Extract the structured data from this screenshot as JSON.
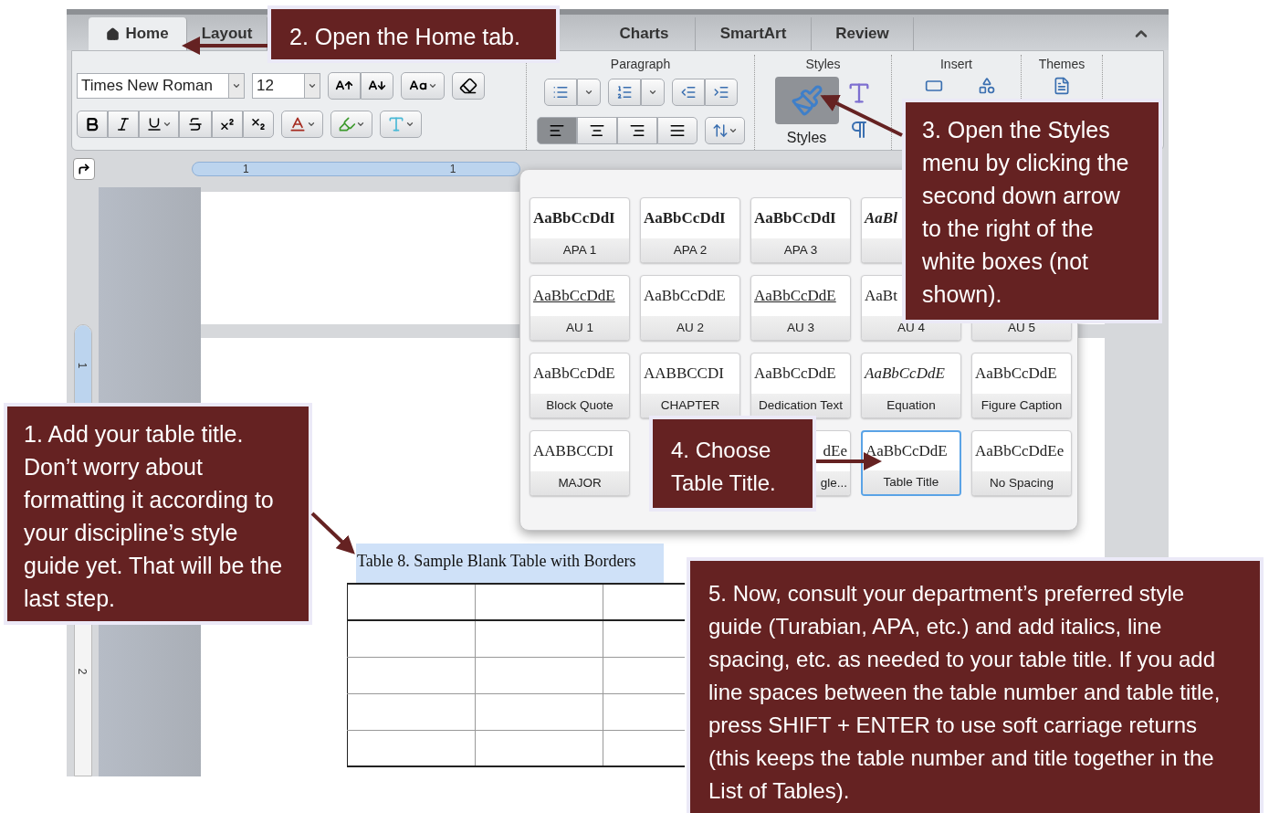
{
  "tabs": [
    {
      "label": "Home",
      "selected": true
    },
    {
      "label": "Layout",
      "selected": false
    },
    {
      "label": "Charts",
      "selected": false
    },
    {
      "label": "SmartArt",
      "selected": false
    },
    {
      "label": "Review",
      "selected": false
    }
  ],
  "ribbon": {
    "font_name": "Times New Roman",
    "font_size": "12",
    "groups": [
      {
        "label": "Paragraph"
      },
      {
        "label": "Styles"
      },
      {
        "label": "Insert"
      },
      {
        "label": "Themes"
      }
    ],
    "alignment": [
      {
        "kind": "left",
        "selected": true
      },
      {
        "kind": "center",
        "selected": false
      },
      {
        "kind": "right",
        "selected": false
      },
      {
        "kind": "justify",
        "selected": false
      }
    ],
    "styles_button": "Styles"
  },
  "horizontal_ruler": [
    "1",
    "1"
  ],
  "vertical_ruler": [
    "1",
    "2"
  ],
  "styles_gallery": {
    "rows": [
      [
        {
          "sample": "AaBbCcDdI",
          "kind": "bold",
          "label": "APA 1",
          "selected": false
        },
        {
          "sample": "AaBbCcDdI",
          "kind": "bold",
          "label": "APA 2",
          "selected": false
        },
        {
          "sample": "AaBbCcDdI",
          "kind": "bold",
          "label": "APA 3",
          "selected": false
        },
        {
          "sample": "AaBl",
          "kind": "bolditalic",
          "selected": false
        },
        null
      ],
      [
        {
          "sample": "AaBbCcDdE",
          "kind": "underline",
          "label": "AU 1",
          "selected": false
        },
        {
          "sample": "AaBbCcDdE",
          "kind": "plain",
          "label": "AU 2",
          "selected": false
        },
        {
          "sample": "AaBbCcDdE",
          "kind": "underline",
          "label": "AU 3",
          "selected": false
        },
        {
          "sample": "AaBt",
          "kind": "plain",
          "label": "AU 4",
          "selected": false
        },
        {
          "label": "AU 5",
          "kind": "plain",
          "selected": false
        }
      ],
      [
        {
          "sample": "AaBbCcDdE",
          "kind": "plain",
          "label": "Block Quote",
          "selected": false
        },
        {
          "sample": "AABBCCDI",
          "kind": "plain",
          "label": "CHAPTER",
          "selected": false
        },
        {
          "sample": "AaBbCcDdE",
          "kind": "plain",
          "label": "Dedication Text",
          "selected": false
        },
        {
          "sample": "AaBbCcDdE",
          "kind": "italic",
          "label": "Equation",
          "selected": false
        },
        {
          "sample": "AaBbCcDdE",
          "kind": "plain",
          "label": "Figure Caption",
          "selected": false
        }
      ],
      [
        {
          "sample": "AABBCCDI",
          "kind": "plain",
          "label": "MAJOR",
          "selected": false
        },
        null,
        {
          "sample": "dEe",
          "kind": "clipped",
          "label": "gle...",
          "selected": false
        },
        {
          "sample": "AaBbCcDdE",
          "kind": "plain",
          "label": "Table Title",
          "selected": true
        },
        {
          "sample": "AaBbCcDdEe",
          "kind": "small",
          "label": "No Spacing",
          "selected": false
        }
      ]
    ]
  },
  "document": {
    "table_title": "Table 8. Sample Blank Table with Borders"
  },
  "callouts": [
    {
      "kind": "step2",
      "text": "2. Open the Home tab."
    },
    {
      "kind": "step3",
      "text": "3. Open the Styles menu by clicking the second down arrow to the right of the white boxes (not shown)."
    },
    {
      "kind": "step1",
      "text": "1. Add your table title. Don’t worry about formatting it according to your discipline’s style guide yet. That will be the last step."
    },
    {
      "kind": "step4",
      "text": "4. Choose Table Title."
    },
    {
      "kind": "step5",
      "text": "5. Now, consult your department’s preferred style guide (Turabian, APA, etc.) and add italics, line spacing, etc. as needed to your table title. If you add line spaces between the table number and table title, press SHIFT + ENTER to use soft carriage returns (this keeps the table number and title together in the List of Tables)."
    }
  ]
}
